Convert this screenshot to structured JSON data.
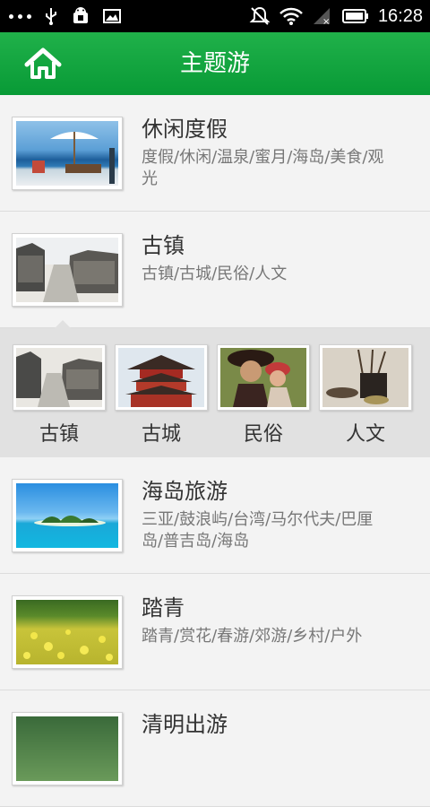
{
  "status_bar": {
    "time": "16:28"
  },
  "app_bar": {
    "title": "主题游",
    "home_icon": "home-icon"
  },
  "themes": [
    {
      "name": "休闲度假",
      "tags": "度假/休闲/温泉/蜜月/海岛/美食/观光",
      "image": "beach-umbrella"
    },
    {
      "name": "古镇",
      "tags": "古镇/古城/民俗/人文",
      "image": "water-town"
    },
    {
      "name": "海岛旅游",
      "tags": "三亚/鼓浪屿/台湾/马尔代夫/巴厘岛/普吉岛/海岛",
      "image": "island"
    },
    {
      "name": "踏青",
      "tags": "踏青/赏花/春游/郊游/乡村/户外",
      "image": "flower-field"
    },
    {
      "name": "清明出游",
      "tags": "",
      "image": "green"
    }
  ],
  "subcategories": [
    {
      "label": "古镇",
      "image": "water-town"
    },
    {
      "label": "古城",
      "image": "pagoda"
    },
    {
      "label": "民俗",
      "image": "ethnic-people"
    },
    {
      "label": "人文",
      "image": "calligraphy"
    }
  ]
}
